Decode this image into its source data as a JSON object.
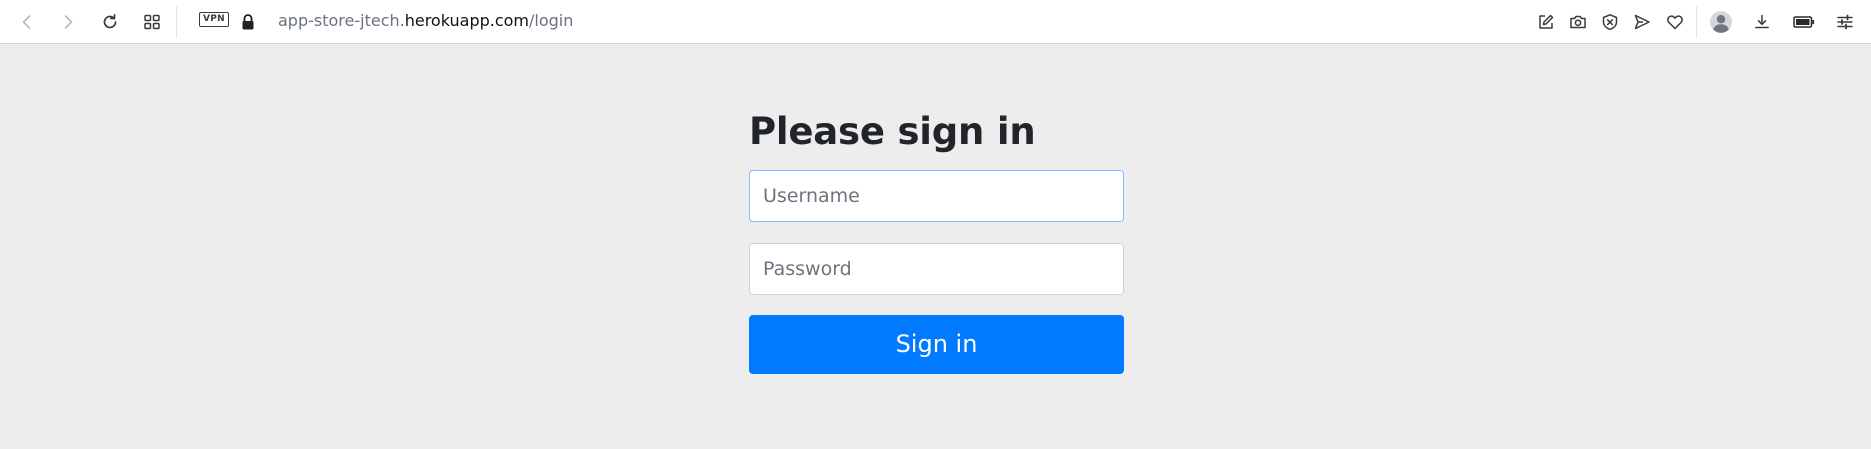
{
  "browser": {
    "vpn_label": "VPN",
    "url_subdomain": "app-store-jtech.",
    "url_host": "herokuapp.com",
    "url_path": "/login",
    "icons": [
      "back-icon",
      "forward-icon",
      "reload-icon",
      "tabs-grid-icon",
      "vpn-badge",
      "lock-icon",
      "edit-icon",
      "camera-icon",
      "adblock-icon",
      "send-icon",
      "heart-icon",
      "profile-icon",
      "download-icon",
      "battery-icon",
      "settings-sliders-icon"
    ]
  },
  "login": {
    "heading": "Please sign in",
    "username_placeholder": "Username",
    "password_placeholder": "Password",
    "submit_label": "Sign in"
  },
  "colors": {
    "page_background": "#ededed",
    "primary_button": "#007bff",
    "focus_border": "#80bdff",
    "heading_text": "#212529"
  }
}
